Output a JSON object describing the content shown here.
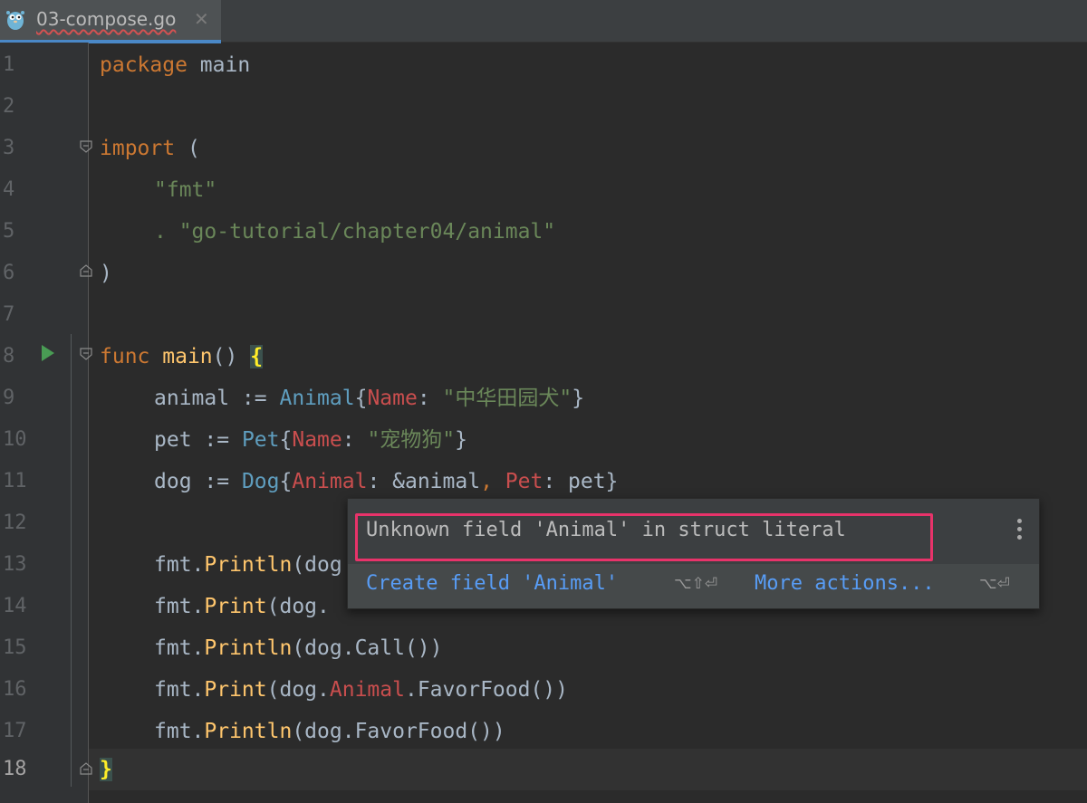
{
  "tab": {
    "title": "03-compose.go",
    "close": "✕",
    "icon": "gopher-icon"
  },
  "gutter": {
    "line_numbers": [
      "1",
      "2",
      "3",
      "4",
      "5",
      "6",
      "7",
      "8",
      "9",
      "10",
      "11",
      "12",
      "13",
      "14",
      "15",
      "16",
      "17",
      "18"
    ],
    "run_line": "8"
  },
  "code": {
    "l1": {
      "kw": "package",
      "rest": " main"
    },
    "l3": {
      "kw": "import",
      "rest": " ("
    },
    "l4": {
      "str": "\"fmt\""
    },
    "l5": {
      "dot": ". ",
      "str": "\"go-tutorial/chapter04/animal\""
    },
    "l6": {
      "text": ")"
    },
    "l8": {
      "kw": "func",
      "fn": "main",
      "paren": "()",
      "brace": "{"
    },
    "l9": {
      "var": "animal := ",
      "type": "Animal",
      "open": "{",
      "field": "Name",
      "colon": ": ",
      "str": "\"中华田园犬\"",
      "close": "}"
    },
    "l10": {
      "var": "pet := ",
      "type": "Pet",
      "open": "{",
      "field": "Name",
      "colon": ": ",
      "str": "\"宠物狗\"",
      "close": "}"
    },
    "l11": {
      "var": "dog := ",
      "type": "Dog",
      "open": "{",
      "field1": "Animal",
      "mid": ": &animal",
      "comma": ", ",
      "field2": "Pet",
      "end": ": pet}"
    },
    "l13": {
      "pkg": "fmt.",
      "fn": "Println",
      "rest": "(dog"
    },
    "l14": {
      "pkg": "fmt.",
      "fn": "Print",
      "rest": "(dog."
    },
    "l15": {
      "pkg": "fmt.",
      "fn": "Println",
      "rest": "(dog.Call())"
    },
    "l16": {
      "pkg": "fmt.",
      "fn": "Print",
      "pre": "(dog.",
      "field": "Animal",
      "rest": ".FavorFood())"
    },
    "l17": {
      "pkg": "fmt.",
      "fn": "Println",
      "rest": "(dog.FavorFood())"
    },
    "l18": {
      "brace": "}"
    }
  },
  "popup": {
    "message": "Unknown field 'Animal' in struct literal",
    "action1": "Create field 'Animal'",
    "shortcut1": "⌥⇧⏎",
    "action2": "More actions...",
    "shortcut2": "⌥⏎"
  },
  "colors": {
    "background": "#2b2b2b",
    "keyword": "#cc7832",
    "string": "#6a8759",
    "type": "#5f9ebf",
    "field_error": "#c94e4e",
    "popup_highlight_border": "#e8336a",
    "link": "#589df6"
  }
}
